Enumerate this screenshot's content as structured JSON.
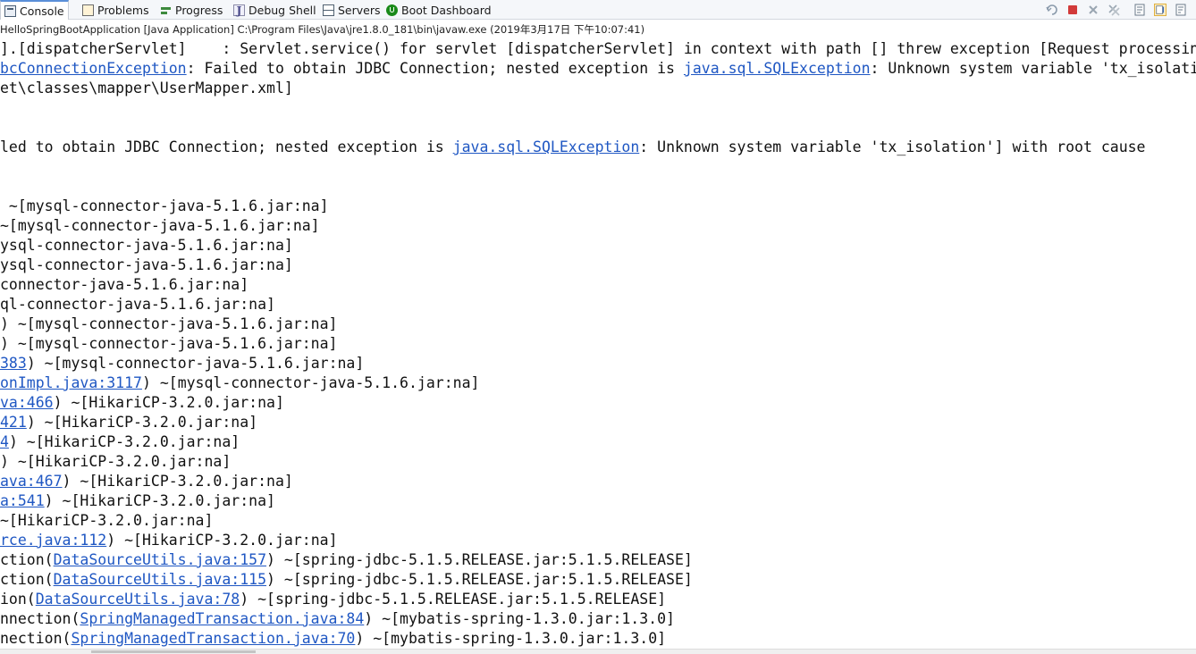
{
  "tabs": [
    {
      "label": "Console",
      "icon": "console-icon",
      "active": true
    },
    {
      "label": "Problems",
      "icon": "problems-icon"
    },
    {
      "label": "Progress",
      "icon": "progress-icon"
    },
    {
      "label": "Debug Shell",
      "icon": "debug-shell-icon"
    },
    {
      "label": "Servers",
      "icon": "servers-icon"
    },
    {
      "label": "Boot Dashboard",
      "icon": "boot-dashboard-icon"
    }
  ],
  "toolbar_icons": [
    "disconnect-icon",
    "terminate-icon",
    "remove-launch-icon",
    "remove-all-icon",
    "clear-console-icon",
    "scroll-lock-icon",
    "word-wrap-icon"
  ],
  "path_text": "HelloSpringBootApplication [Java Application] C:\\Program Files\\Java\\jre1.8.0_181\\bin\\javaw.exe (2019年3月17日 下午10:07:41)",
  "colors": {
    "link": "#1f57c3",
    "text": "#111111",
    "accent": "#5a8fd8"
  },
  "console_lines": [
    {
      "segments": [
        {
          "t": "].[dispatcherServlet]    : Servlet.service() for servlet [dispatcherServlet] in context with path [] threw exception [Request processing"
        }
      ]
    },
    {
      "segments": [
        {
          "t": "bcConnectionException",
          "link": true
        },
        {
          "t": ": Failed to obtain JDBC Connection; nested exception is "
        },
        {
          "t": "java.sql.SQLException",
          "link": true
        },
        {
          "t": ": Unknown system variable 'tx_isolation'"
        }
      ]
    },
    {
      "segments": [
        {
          "t": "et\\classes\\mapper\\UserMapper.xml]"
        }
      ]
    },
    {
      "segments": []
    },
    {
      "segments": []
    },
    {
      "segments": [
        {
          "t": "led to obtain JDBC Connection; nested exception is "
        },
        {
          "t": "java.sql.SQLException",
          "link": true
        },
        {
          "t": ": Unknown system variable 'tx_isolation'] with root cause"
        }
      ]
    },
    {
      "segments": []
    },
    {
      "segments": []
    },
    {
      "segments": [
        {
          "t": " ~[mysql-connector-java-5.1.6.jar:na]"
        }
      ]
    },
    {
      "segments": [
        {
          "t": "~[mysql-connector-java-5.1.6.jar:na]"
        }
      ]
    },
    {
      "segments": [
        {
          "t": "ysql-connector-java-5.1.6.jar:na]"
        }
      ]
    },
    {
      "segments": [
        {
          "t": "ysql-connector-java-5.1.6.jar:na]"
        }
      ]
    },
    {
      "segments": [
        {
          "t": "connector-java-5.1.6.jar:na]"
        }
      ]
    },
    {
      "segments": [
        {
          "t": "ql-connector-java-5.1.6.jar:na]"
        }
      ]
    },
    {
      "segments": [
        {
          "t": ") ~[mysql-connector-java-5.1.6.jar:na]"
        }
      ]
    },
    {
      "segments": [
        {
          "t": ") ~[mysql-connector-java-5.1.6.jar:na]"
        }
      ]
    },
    {
      "segments": [
        {
          "t": "383",
          "link": true
        },
        {
          "t": ") ~[mysql-connector-java-5.1.6.jar:na]"
        }
      ]
    },
    {
      "segments": [
        {
          "t": "onImpl.java:3117",
          "link": true
        },
        {
          "t": ") ~[mysql-connector-java-5.1.6.jar:na]"
        }
      ]
    },
    {
      "segments": [
        {
          "t": "va:466",
          "link": true
        },
        {
          "t": ") ~[HikariCP-3.2.0.jar:na]"
        }
      ]
    },
    {
      "segments": [
        {
          "t": "421",
          "link": true
        },
        {
          "t": ") ~[HikariCP-3.2.0.jar:na]"
        }
      ]
    },
    {
      "segments": [
        {
          "t": "4",
          "link": true
        },
        {
          "t": ") ~[HikariCP-3.2.0.jar:na]"
        }
      ]
    },
    {
      "segments": [
        {
          "t": ") ~[HikariCP-3.2.0.jar:na]"
        }
      ]
    },
    {
      "segments": [
        {
          "t": "ava:467",
          "link": true
        },
        {
          "t": ") ~[HikariCP-3.2.0.jar:na]"
        }
      ]
    },
    {
      "segments": [
        {
          "t": "a:541",
          "link": true
        },
        {
          "t": ") ~[HikariCP-3.2.0.jar:na]"
        }
      ]
    },
    {
      "segments": [
        {
          "t": "~[HikariCP-3.2.0.jar:na]"
        }
      ]
    },
    {
      "segments": [
        {
          "t": "rce.java:112",
          "link": true
        },
        {
          "t": ") ~[HikariCP-3.2.0.jar:na]"
        }
      ]
    },
    {
      "segments": [
        {
          "t": "ction("
        },
        {
          "t": "DataSourceUtils.java:157",
          "link": true
        },
        {
          "t": ") ~[spring-jdbc-5.1.5.RELEASE.jar:5.1.5.RELEASE]"
        }
      ]
    },
    {
      "segments": [
        {
          "t": "ction("
        },
        {
          "t": "DataSourceUtils.java:115",
          "link": true
        },
        {
          "t": ") ~[spring-jdbc-5.1.5.RELEASE.jar:5.1.5.RELEASE]"
        }
      ]
    },
    {
      "segments": [
        {
          "t": "ion("
        },
        {
          "t": "DataSourceUtils.java:78",
          "link": true
        },
        {
          "t": ") ~[spring-jdbc-5.1.5.RELEASE.jar:5.1.5.RELEASE]"
        }
      ]
    },
    {
      "segments": [
        {
          "t": "nnection("
        },
        {
          "t": "SpringManagedTransaction.java:84",
          "link": true
        },
        {
          "t": ") ~[mybatis-spring-1.3.0.jar:1.3.0]"
        }
      ]
    },
    {
      "segments": [
        {
          "t": "nection("
        },
        {
          "t": "SpringManagedTransaction.java:70",
          "link": true
        },
        {
          "t": ") ~[mybatis-spring-1.3.0.jar:1.3.0]"
        }
      ]
    }
  ]
}
